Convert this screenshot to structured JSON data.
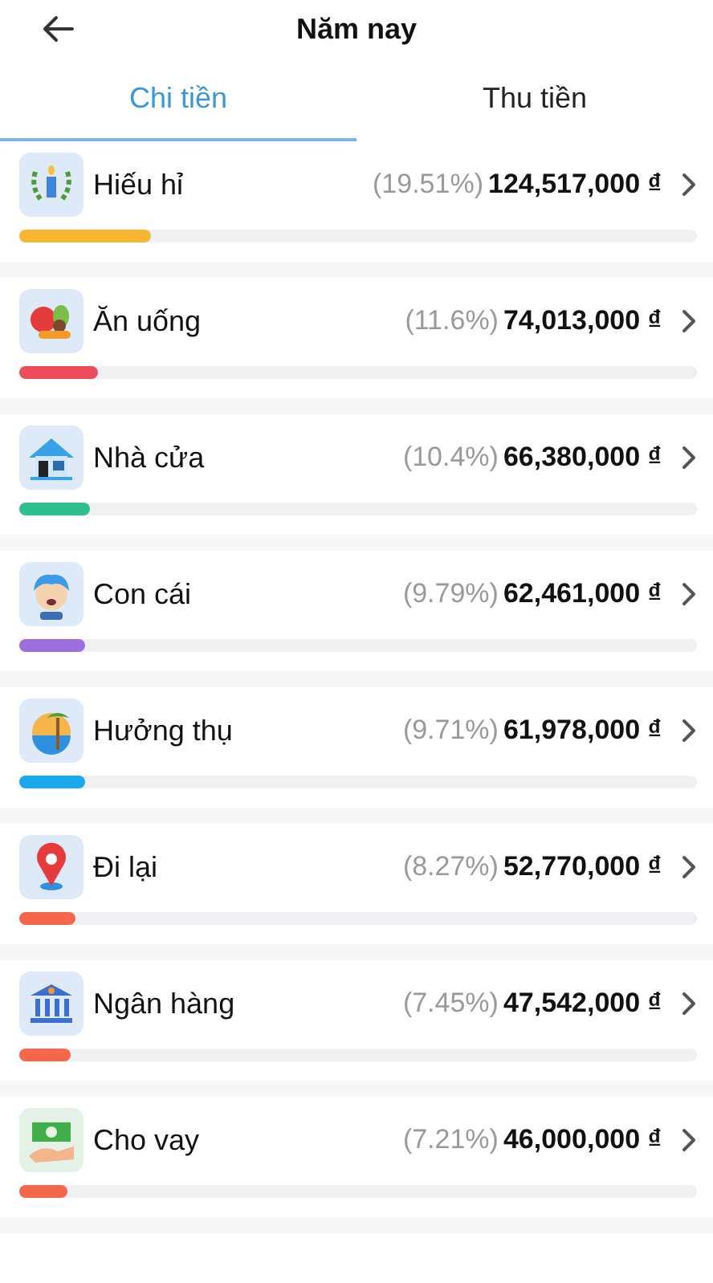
{
  "header": {
    "title": "Năm nay"
  },
  "tabs": [
    {
      "label": "Chi tiền",
      "selected": true
    },
    {
      "label": "Thu tiền",
      "selected": false
    }
  ],
  "categories": [
    {
      "kind": "wreath",
      "name": "Hiếu hỉ",
      "percent": "(19.51%)",
      "amount": "124,517,000 ₫",
      "level": 0.195,
      "color": "#f7b731"
    },
    {
      "kind": "food",
      "name": "Ăn uống",
      "percent": "(11.6%)",
      "amount": "74,013,000 ₫",
      "level": 0.116,
      "color": "#eb4d5c"
    },
    {
      "kind": "house",
      "name": "Nhà cửa",
      "percent": "(10.4%)",
      "amount": "66,380,000 ₫",
      "level": 0.104,
      "color": "#2fbf8f"
    },
    {
      "kind": "child",
      "name": "Con cái",
      "percent": "(9.79%)",
      "amount": "62,461,000 ₫",
      "level": 0.098,
      "color": "#9b6fe0"
    },
    {
      "kind": "beach",
      "name": "Hưởng thụ",
      "percent": "(9.71%)",
      "amount": "61,978,000 ₫",
      "level": 0.097,
      "color": "#1aa7ec"
    },
    {
      "kind": "pin",
      "name": "Đi lại",
      "percent": "(8.27%)",
      "amount": "52,770,000 ₫",
      "level": 0.083,
      "color": "#f5674d"
    },
    {
      "kind": "bank",
      "name": "Ngân hàng",
      "percent": "(7.45%)",
      "amount": "47,542,000 ₫",
      "level": 0.075,
      "color": "#f5674d"
    },
    {
      "kind": "loan",
      "name": "Cho vay",
      "percent": "(7.21%)",
      "amount": "46,000,000 ₫",
      "level": 0.072,
      "color": "#f5674d"
    }
  ]
}
